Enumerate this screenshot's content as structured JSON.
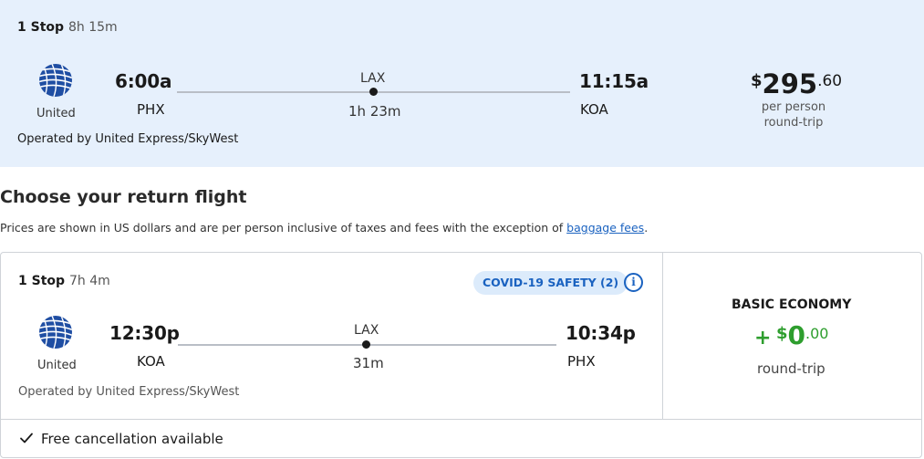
{
  "outbound": {
    "stops": "1 Stop",
    "duration": "8h 15m",
    "depart_time": "6:00a",
    "arrive_time": "11:15a",
    "origin": "PHX",
    "destination": "KOA",
    "via": "LAX",
    "layover": "1h 23m",
    "airline": "United",
    "operated_by": "Operated by United Express/SkyWest",
    "price_currency": "$",
    "price_main": "295",
    "price_cents": ".60",
    "price_sub1": "per person",
    "price_sub2": "round-trip"
  },
  "section": {
    "heading": "Choose your return flight",
    "notice": "Prices are shown in US dollars and are per person inclusive of taxes and fees with the exception of",
    "notice_link": "baggage fees",
    "notice_end": "."
  },
  "return_flight": {
    "stops": "1 Stop",
    "duration": "7h 4m",
    "covid_badge": "COVID-19 SAFETY (2)",
    "info_glyph": "i",
    "depart_time": "12:30p",
    "arrive_time": "10:34p",
    "origin": "KOA",
    "destination": "PHX",
    "via": "LAX",
    "layover": "31m",
    "airline": "United",
    "operated_by": "Operated by United Express/SkyWest",
    "fare_class": "BASIC ECONOMY",
    "fare_plus": "+",
    "fare_currency": "$",
    "fare_main": "0",
    "fare_cents": ".00",
    "fare_sub": "round-trip",
    "free_cancellation": "Free cancellation available"
  },
  "icons": {
    "airline_logo": "united-globe-logo",
    "info": "info-circle-icon",
    "check": "checkmark-icon"
  },
  "colors": {
    "top_background": "#e6f0fc",
    "accent_blue": "#1a62c0",
    "price_green": "#2e9e2e",
    "united_blue": "#1f4ea3"
  }
}
